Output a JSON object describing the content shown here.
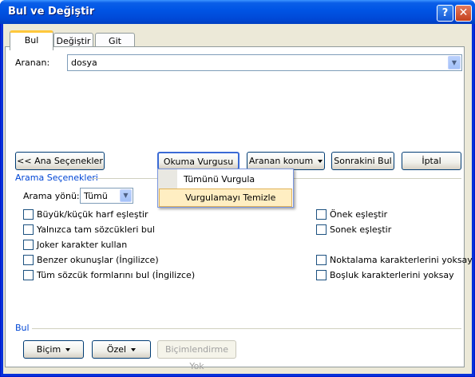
{
  "window": {
    "title": "Bul ve Değiştir",
    "help_label": "?",
    "close_label": "✕"
  },
  "tabs": [
    {
      "label": "Bul"
    },
    {
      "label": "Değiştir"
    },
    {
      "label": "Git"
    }
  ],
  "find": {
    "label": "Aranan:",
    "value": "dosya"
  },
  "buttons": {
    "less_options": "<< Ana Seçenekler",
    "reading_highlight": "Okuma Vurgusu",
    "find_in": "Aranan konum",
    "find_next": "Sonrakini Bul",
    "cancel": "İptal"
  },
  "dropdown_menu": {
    "items": [
      {
        "label": "Tümünü Vurgula"
      },
      {
        "label": "Vurgulamayı Temizle"
      }
    ]
  },
  "search_options": {
    "heading": "Arama Seçenekleri",
    "direction_label": "Arama yönü:",
    "direction_value": "Tümü",
    "left_options": [
      "Büyük/küçük harf eşleştir",
      "Yalnızca tam sözcükleri bul",
      "Joker karakter kullan",
      "Benzer okunuşlar (İngilizce)",
      "Tüm sözcük formlarını bul (İngilizce)"
    ],
    "right_options": [
      "Önek eşleştir",
      "Sonek eşleştir",
      "Noktalama karakterlerini yoksay",
      "Boşluk karakterlerini yoksay"
    ]
  },
  "find_section": {
    "heading": "Bul",
    "format_label": "Biçim",
    "special_label": "Özel",
    "no_formatting_label": "Biçimlendirme Yok"
  }
}
